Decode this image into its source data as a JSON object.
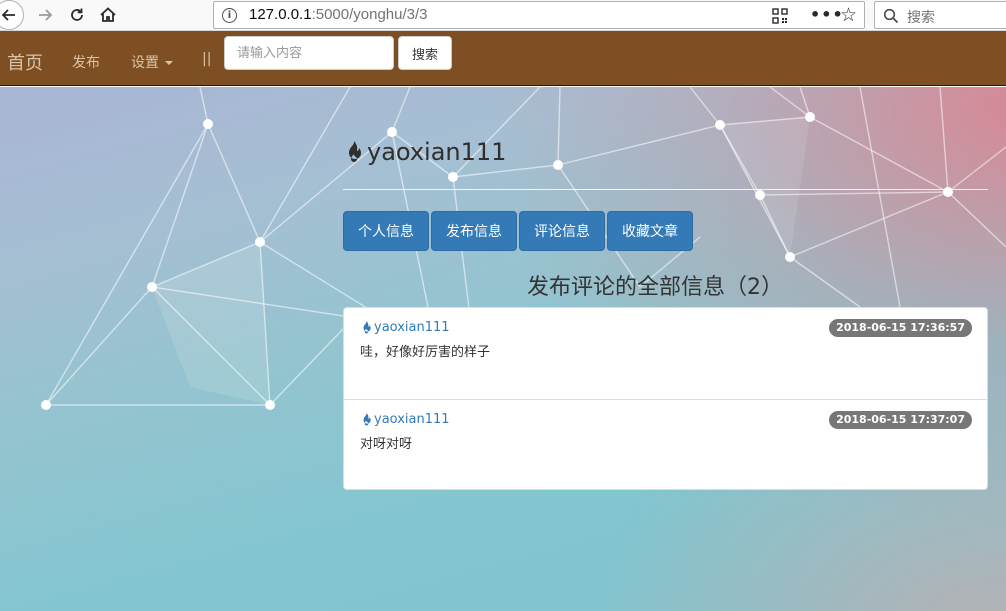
{
  "browser": {
    "url_host": "127.0.0.1",
    "url_rest": ":5000/yonghu/3/3",
    "search_placeholder": "搜索",
    "more_glyph": "•••"
  },
  "navbar": {
    "brand": "首页",
    "publish": "发布",
    "settings": "设置",
    "separator": "||",
    "search_placeholder": "请输入内容",
    "search_button": "搜索",
    "bg_color": "#7e4f23"
  },
  "profile": {
    "username": "yaoxian111",
    "tabs": [
      {
        "label": "个人信息"
      },
      {
        "label": "发布信息"
      },
      {
        "label": "评论信息"
      },
      {
        "label": "收藏文章"
      }
    ]
  },
  "comments": {
    "title": "发布评论的全部信息（2）",
    "items": [
      {
        "author": "yaoxian111",
        "time": "2018-06-15 17:36:57",
        "text": "哇，好像好厉害的样子"
      },
      {
        "author": "yaoxian111",
        "time": "2018-06-15 17:37:07",
        "text": "对呀对呀"
      }
    ]
  },
  "colors": {
    "primary": "#337ab7",
    "badge": "#777777"
  },
  "icons": [
    "back-icon",
    "forward-icon",
    "reload-icon",
    "home-icon",
    "info-icon",
    "qr-code-icon",
    "more-icon",
    "star-icon",
    "search-icon",
    "fire-icon"
  ]
}
